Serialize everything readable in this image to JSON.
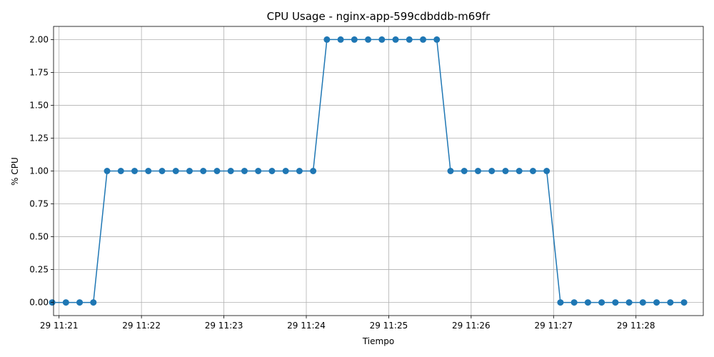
{
  "chart_data": {
    "type": "line",
    "title": "CPU Usage - nginx-app-599cdbddb-m69fr",
    "xlabel": "Tiempo",
    "ylabel": "% CPU",
    "x_ticks": [
      "29 11:21",
      "29 11:22",
      "29 11:23",
      "29 11:24",
      "29 11:25",
      "29 11:26",
      "29 11:27",
      "29 11:28"
    ],
    "y_ticks": [
      "0.00",
      "0.25",
      "0.50",
      "0.75",
      "1.00",
      "1.25",
      "1.50",
      "1.75",
      "2.00"
    ],
    "xlim": [
      "11:20:56",
      "11:28:49"
    ],
    "ylim": [
      -0.1,
      2.1
    ],
    "grid": true,
    "marker": "circle",
    "color": "#1f77b4",
    "series": [
      {
        "x": [
          "11:20:55",
          "11:21:05",
          "11:21:15",
          "11:21:25",
          "11:21:35",
          "11:21:45",
          "11:21:55",
          "11:22:05",
          "11:22:15",
          "11:22:25",
          "11:22:35",
          "11:22:45",
          "11:22:55",
          "11:23:05",
          "11:23:15",
          "11:23:25",
          "11:23:35",
          "11:23:45",
          "11:23:55",
          "11:24:05",
          "11:24:15",
          "11:24:25",
          "11:24:35",
          "11:24:45",
          "11:24:55",
          "11:25:05",
          "11:25:15",
          "11:25:25",
          "11:25:35",
          "11:25:45",
          "11:25:55",
          "11:26:05",
          "11:26:15",
          "11:26:25",
          "11:26:35",
          "11:26:45",
          "11:26:55",
          "11:27:05",
          "11:27:15",
          "11:27:25",
          "11:27:35",
          "11:27:45",
          "11:27:55",
          "11:28:05",
          "11:28:15",
          "11:28:25",
          "11:28:35"
        ],
        "values": [
          0,
          0,
          0,
          0,
          1,
          1,
          1,
          1,
          1,
          1,
          1,
          1,
          1,
          1,
          1,
          1,
          1,
          1,
          1,
          1,
          2,
          2,
          2,
          2,
          2,
          2,
          2,
          2,
          2,
          1,
          1,
          1,
          1,
          1,
          1,
          1,
          1,
          0,
          0,
          0,
          0,
          0,
          0,
          0,
          0,
          0,
          0
        ]
      }
    ]
  }
}
